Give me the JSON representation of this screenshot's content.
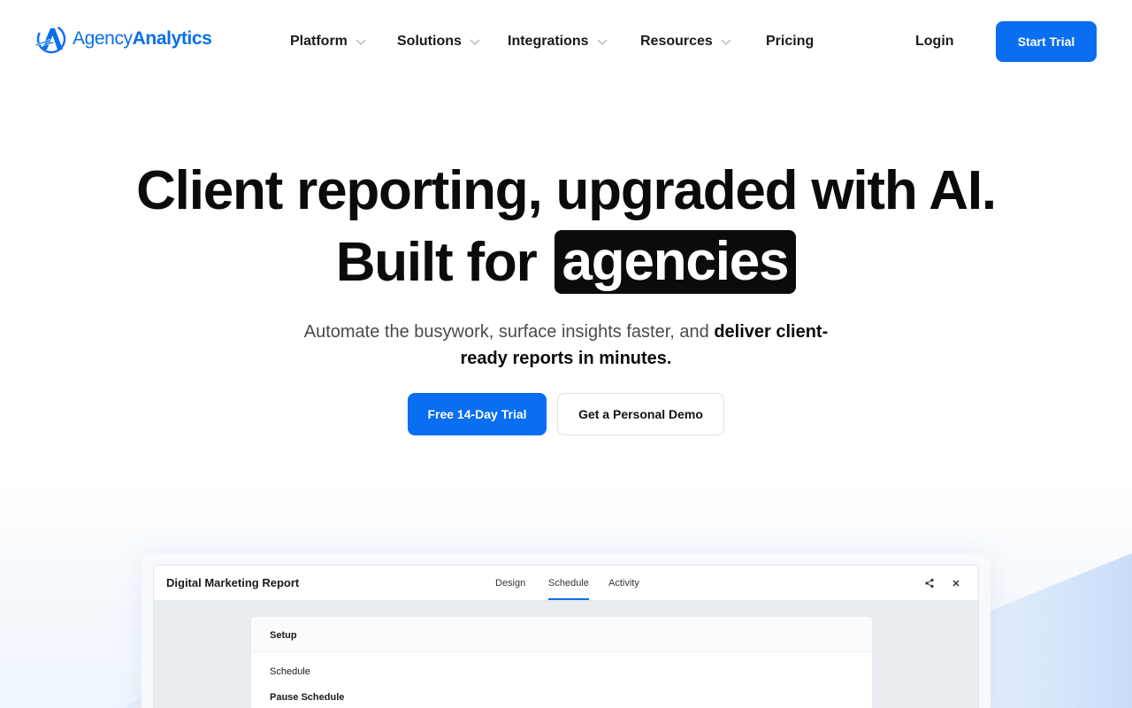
{
  "brand": {
    "name_light": "Agency",
    "name_bold": "Analytics",
    "color": "#0a6ef0",
    "icon": "agency-analytics-logo-icon"
  },
  "nav": {
    "items": [
      {
        "label": "Platform",
        "has_dropdown": true
      },
      {
        "label": "Solutions",
        "has_dropdown": true
      },
      {
        "label": "Integrations",
        "has_dropdown": true
      },
      {
        "label": "Resources",
        "has_dropdown": true
      },
      {
        "label": "Pricing",
        "has_dropdown": false
      }
    ],
    "login_label": "Login",
    "start_trial_label": "Start Trial"
  },
  "hero": {
    "line1": "Client reporting, upgraded with AI.",
    "line2_prefix": "Built for",
    "line2_highlight": "agencies",
    "sub_regular": "Automate the busywork, surface insights faster, and ",
    "sub_bold": "deliver client-ready reports in minutes.",
    "primary_cta": "Free 14-Day Trial",
    "secondary_cta": "Get a Personal Demo"
  },
  "mockup": {
    "title": "Digital Marketing Report",
    "tabs": [
      {
        "label": "Design",
        "active": false
      },
      {
        "label": "Schedule",
        "active": true
      },
      {
        "label": "Activity",
        "active": false
      }
    ],
    "icons": [
      "share-icon",
      "close-icon"
    ],
    "panel": {
      "heading": "Setup",
      "rows": [
        "Schedule",
        "Pause Schedule"
      ]
    }
  }
}
